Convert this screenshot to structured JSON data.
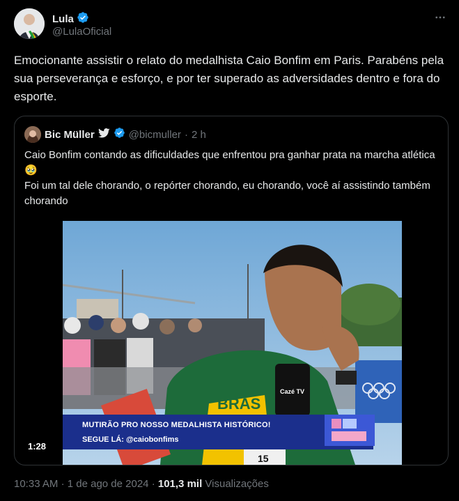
{
  "author": {
    "name": "Lula",
    "handle": "@LulaOficial",
    "verified": true,
    "avatar_icon": "profile-photo"
  },
  "more_icon": "ellipsis-icon",
  "tweet": {
    "text": "Emocionante assistir o relato do medalhista Caio Bonfim em Paris. Parabéns pela sua perseverança e esforço, e por ter superado as adversidades dentro e fora do esporte."
  },
  "quoted": {
    "name": "Bic Müller",
    "handle": "@bicmuller",
    "time": "2 h",
    "separator": "·",
    "line1": "Caio Bonfim contando as dificuldades que enfrentou pra ganhar prata na marcha atlética 🥹",
    "line2": "Foi um tal dele chorando, o repórter chorando, eu chorando, você aí assistindo também chorando",
    "video": {
      "duration": "1:28",
      "banner_line1": "MUTIRÃO PRO NOSSO MEDALHISTA HISTÓRICO!",
      "banner_line2": "SEGUE LÁ: @caiobonfims",
      "mic_label": "Cazé TV",
      "shirt_text": "BRAS",
      "bib_number": "15"
    }
  },
  "meta": {
    "time": "10:33 AM",
    "separator": "·",
    "date": "1 de ago de 2024",
    "views_count": "101,3 mil",
    "views_label": "Visualizações"
  },
  "colors": {
    "background": "#000000",
    "text": "#e7e9ea",
    "muted": "#71767b",
    "verified": "#1d9bf0",
    "border": "#2f3336"
  }
}
